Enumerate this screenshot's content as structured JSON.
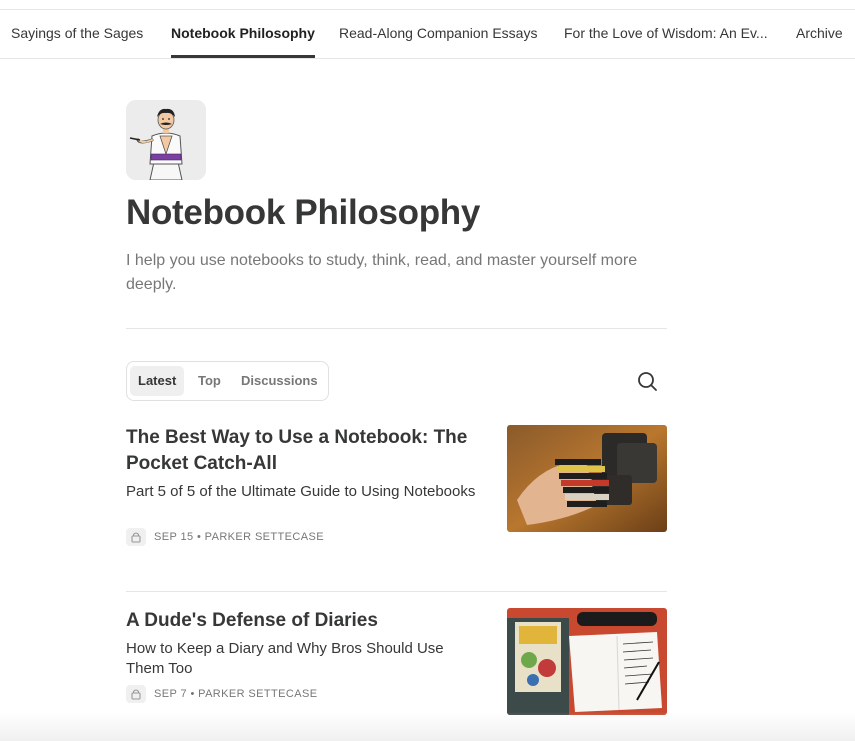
{
  "nav": {
    "tabs": [
      {
        "label": "Sayings of the Sages"
      },
      {
        "label": "Notebook Philosophy"
      },
      {
        "label": "Read-Along Companion Essays"
      },
      {
        "label": "For the Love of Wisdom: An Ev..."
      },
      {
        "label": "Archive"
      }
    ],
    "active_index": 1
  },
  "publication": {
    "title": "Notebook Philosophy",
    "description": "I help you use notebooks to study, think, read, and master yourself more deeply."
  },
  "post_tabs": {
    "items": [
      {
        "label": "Latest"
      },
      {
        "label": "Top"
      },
      {
        "label": "Discussions"
      }
    ],
    "active_index": 0
  },
  "search": {
    "icon": "search-icon"
  },
  "posts": [
    {
      "title": "The Best Way to Use a Notebook: The Pocket Catch-All",
      "subtitle": "Part 5 of 5 of the Ultimate Guide to Using Notebooks",
      "meta": "SEP 15 • PARKER SETTECASE",
      "locked": true
    },
    {
      "title": "A Dude's Defense of Diaries",
      "subtitle": "How to Keep a Diary and Why Bros Should Use Them Too",
      "meta": "SEP 7 • PARKER SETTECASE",
      "locked": true
    }
  ],
  "colors": {
    "text": "#363737",
    "muted": "#777777",
    "divider": "#e6e6e6"
  }
}
